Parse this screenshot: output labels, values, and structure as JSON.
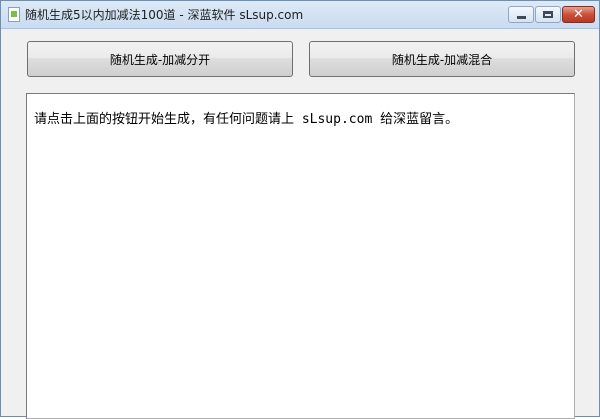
{
  "window": {
    "title": "随机生成5以内加减法100道 - 深蓝软件 sLsup.com",
    "close_glyph": "✕"
  },
  "icons": {
    "app": "document-icon",
    "minimize": "minimize-icon",
    "maximize": "maximize-icon",
    "close": "close-icon"
  },
  "toolbar": {
    "generate_split_label": "随机生成-加减分开",
    "generate_mixed_label": "随机生成-加减混合"
  },
  "output": {
    "text": "请点击上面的按钮开始生成，有任何问题请上 sLsup.com 给深蓝留言。"
  }
}
